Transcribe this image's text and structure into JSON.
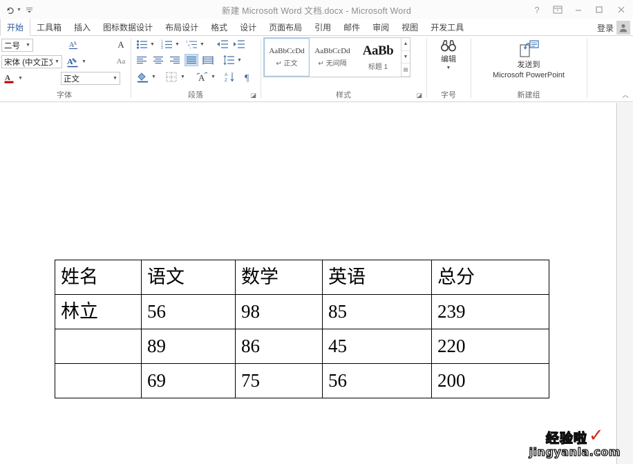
{
  "titlebar": {
    "document_title": "新建 Microsoft Word 文档.docx - Microsoft Word",
    "qat": [
      {
        "name": "redo-icon",
        "label": "重复"
      },
      {
        "name": "customize-quick-access-toolbar-icon",
        "label": "自定义快速访问工具栏"
      }
    ],
    "help_label": "?",
    "ribbon_display_label": "功能区显示选项",
    "minimize_label": "最小化",
    "maximize_label": "最大化",
    "close_label": "关闭"
  },
  "tabs": [
    {
      "label": "开始",
      "active": true
    },
    {
      "label": "工具箱",
      "active": false
    },
    {
      "label": "插入",
      "active": false
    },
    {
      "label": "图标数据设计",
      "active": false
    },
    {
      "label": "布局设计",
      "active": false
    },
    {
      "label": "格式",
      "active": false
    },
    {
      "label": "设计",
      "active": false
    },
    {
      "label": "页面布局",
      "active": false
    },
    {
      "label": "引用",
      "active": false
    },
    {
      "label": "邮件",
      "active": false
    },
    {
      "label": "审阅",
      "active": false
    },
    {
      "label": "视图",
      "active": false
    },
    {
      "label": "开发工具",
      "active": false
    }
  ],
  "account": {
    "signin_label": "登录"
  },
  "ribbon": {
    "collapse_label": "折叠功能区",
    "groups": [
      {
        "name": "font",
        "label": "字体",
        "font_size_value": "二号",
        "font_name_value": "宋体 (中文正文)",
        "style_box_value": "正文",
        "grow_font_label": "A",
        "change_case_label": "Aa",
        "text_highlight_label": "A",
        "font_color_label": "A"
      },
      {
        "name": "paragraph",
        "label": "段落",
        "dialog_launcher_label": "段落对话框启动器",
        "buttons": [
          "bullets-icon",
          "numbering-icon",
          "multilevel-list-icon",
          "decrease-indent-icon",
          "increase-indent-icon",
          "align-left-icon",
          "align-center-icon",
          "align-right-icon",
          "justify-icon",
          "distribute-icon",
          "line-spacing-icon",
          "shading-icon",
          "borders-icon",
          "text-effects-icon",
          "sort-icon",
          "show-marks-icon"
        ],
        "selected_button": "justify-icon"
      },
      {
        "name": "styles",
        "label": "样式",
        "dialog_launcher_label": "样式对话框启动器",
        "items": [
          {
            "preview": "AaBbCcDd",
            "name": "↵ 正文",
            "selected": true,
            "big": false
          },
          {
            "preview": "AaBbCcDd",
            "name": "↵ 无间隔",
            "selected": false,
            "big": false
          },
          {
            "preview": "AaBb",
            "name": "标题 1",
            "selected": false,
            "big": true
          }
        ]
      },
      {
        "name": "editing",
        "label": "字号",
        "editing_label": "编辑"
      },
      {
        "name": "new-group",
        "label": "新建组",
        "send_to_label_line1": "发送到",
        "send_to_label_line2": "Microsoft PowerPoint"
      }
    ]
  },
  "document": {
    "table": {
      "headers": [
        "姓名",
        "语文",
        "数学",
        "英语",
        "总分"
      ],
      "rows": [
        [
          "林立",
          "56",
          "98",
          "85",
          "239"
        ],
        [
          "",
          "89",
          "86",
          "45",
          "220"
        ],
        [
          "",
          "69",
          "75",
          "56",
          "200"
        ]
      ]
    }
  },
  "watermark": {
    "cn": "经验啦",
    "check": "✓",
    "en": "jingyanla.com",
    "check_color": "#d42b1e"
  }
}
